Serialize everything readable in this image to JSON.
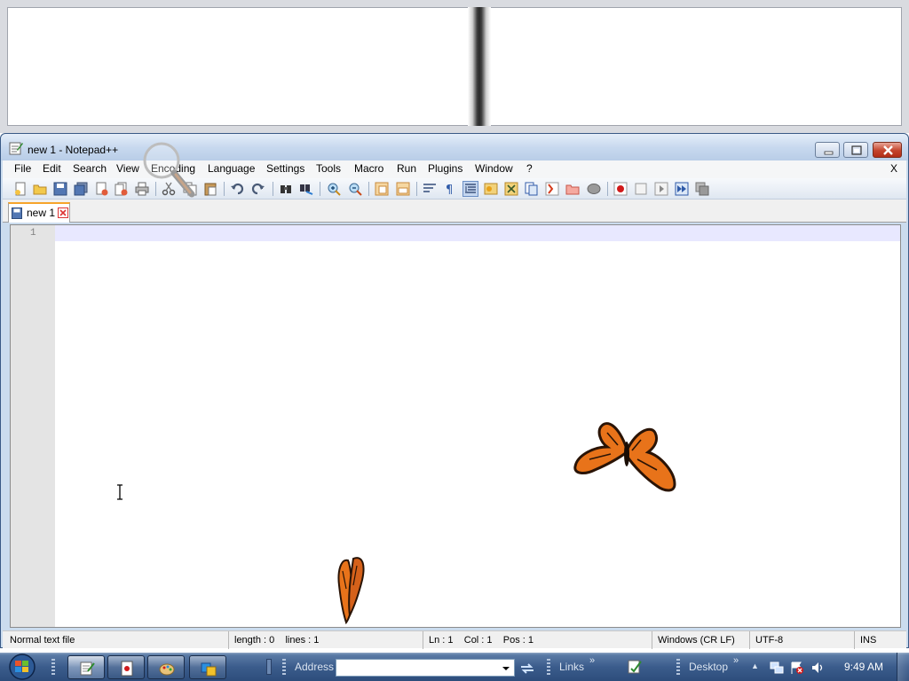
{
  "window": {
    "title": "new 1 - Notepad++",
    "close_x": "X"
  },
  "menu": {
    "items": [
      "File",
      "Edit",
      "Search",
      "View",
      "Encoding",
      "Language",
      "Settings",
      "Tools",
      "Macro",
      "Run",
      "Plugins",
      "Window",
      "?"
    ]
  },
  "toolbar": {
    "icons": [
      "new-file-icon",
      "open-file-icon",
      "save-icon",
      "save-all-icon",
      "close-icon",
      "close-all-icon",
      "print-icon",
      "cut-icon",
      "copy-icon",
      "paste-icon",
      "undo-icon",
      "redo-icon",
      "find-icon",
      "replace-icon",
      "zoom-in-icon",
      "zoom-out-icon",
      "sync-vertical-icon",
      "sync-horizontal-icon",
      "word-wrap-icon",
      "show-all-characters-icon",
      "indent-guide-icon",
      "user-defined-language-icon",
      "document-map-icon",
      "function-list-icon",
      "folder-as-workspace-icon",
      "monitoring-icon",
      "bookmark-icon",
      "start-recording-icon",
      "stop-recording-icon",
      "playback-icon",
      "run-macro-multiple-icon",
      "save-macro-icon"
    ]
  },
  "tabs": [
    {
      "label": "new 1",
      "active": true
    }
  ],
  "editor": {
    "line_numbers": [
      "1"
    ],
    "content": ""
  },
  "statusbar": {
    "file_type": "Normal text file",
    "length_lines": "length : 0    lines : 1",
    "position": "Ln : 1    Col : 1    Pos : 1",
    "eol": "Windows (CR LF)",
    "encoding": "UTF-8",
    "insert_mode": "INS"
  },
  "taskbar": {
    "tasks": [
      {
        "name": "notepad-plus-plus-task",
        "icon": "notepad-icon",
        "active": true
      },
      {
        "name": "solitaire-task",
        "icon": "cards-icon",
        "active": false
      },
      {
        "name": "paint-task",
        "icon": "palette-icon",
        "active": false
      },
      {
        "name": "explorer-task",
        "icon": "window-icon",
        "active": false
      }
    ],
    "address_label": "Address",
    "address_value": "",
    "links_label": "Links",
    "links_chevron": "»",
    "desktop_label": "Desktop",
    "desktop_chevron": "»",
    "tray_arrow": "▲",
    "clock": "9:49 AM"
  },
  "colors": {
    "current_line": "#e8e8ff",
    "gutter": "#e4e4e4",
    "tab_accent": "#f6a42a",
    "taskbar": "#3b5c8c",
    "butterfly_orange": "#e8731a"
  }
}
